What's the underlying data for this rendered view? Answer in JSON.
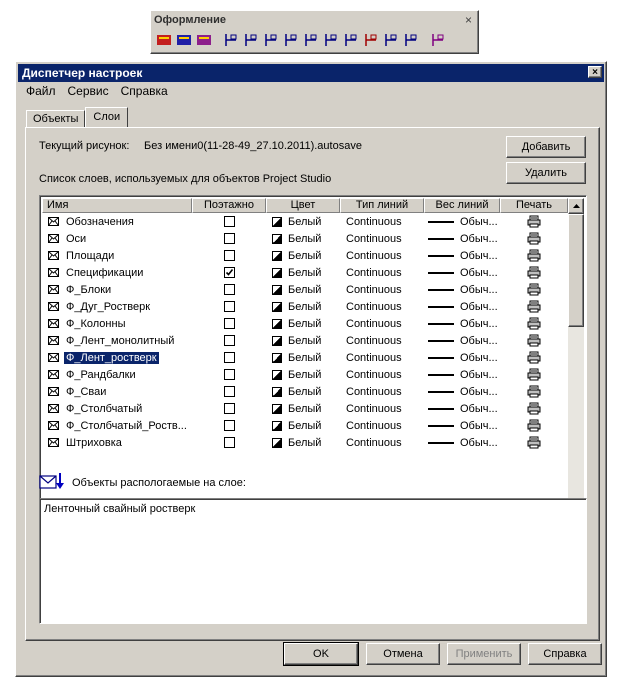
{
  "toolbar": {
    "title": "Оформление",
    "close": "×",
    "icons": [
      "layers-manager-icon",
      "layer-filter-icon",
      "layer-stack-icon",
      "leader-icon",
      "elevation-mark-icon",
      "leader-note-icon",
      "axis-mark-icon",
      "level-mark-icon",
      "frame-icon",
      "section-mark-icon",
      "view-mark-icon",
      "table-icon",
      "title-block-icon",
      "layer-settings-icon"
    ]
  },
  "dialog": {
    "title": "Диспетчер настроек",
    "close": "×",
    "menu": [
      "Файл",
      "Сервис",
      "Справка"
    ],
    "tabs": [
      "Объекты",
      "Слои"
    ],
    "active_tab": "Слои",
    "current_drawing_label": "Текущий рисунок:",
    "current_drawing_value": "Без имени0(11-28-49_27.10.2011).autosave",
    "list_label": "Список слоев, используемых для объектов Project Studio",
    "add_button": "Добавить",
    "delete_button": "Удалить",
    "columns": [
      "Имя",
      "Поэтажно",
      "Цвет",
      "Тип линий",
      "Вес линий",
      "Печать"
    ],
    "rows": [
      {
        "name": "Обозначения",
        "checked": false,
        "color": "Белый",
        "linetype": "Continuous",
        "weight": "Обыч...",
        "selected": false
      },
      {
        "name": "Оси",
        "checked": false,
        "color": "Белый",
        "linetype": "Continuous",
        "weight": "Обыч...",
        "selected": false
      },
      {
        "name": "Площади",
        "checked": false,
        "color": "Белый",
        "linetype": "Continuous",
        "weight": "Обыч...",
        "selected": false
      },
      {
        "name": "Спецификации",
        "checked": true,
        "color": "Белый",
        "linetype": "Continuous",
        "weight": "Обыч...",
        "selected": false
      },
      {
        "name": "Ф_Блоки",
        "checked": false,
        "color": "Белый",
        "linetype": "Continuous",
        "weight": "Обыч...",
        "selected": false
      },
      {
        "name": "Ф_Дуг_Ростверк",
        "checked": false,
        "color": "Белый",
        "linetype": "Continuous",
        "weight": "Обыч...",
        "selected": false
      },
      {
        "name": "Ф_Колонны",
        "checked": false,
        "color": "Белый",
        "linetype": "Continuous",
        "weight": "Обыч...",
        "selected": false
      },
      {
        "name": "Ф_Лент_монолитный",
        "checked": false,
        "color": "Белый",
        "linetype": "Continuous",
        "weight": "Обыч...",
        "selected": false
      },
      {
        "name": "Ф_Лент_ростверк",
        "checked": false,
        "color": "Белый",
        "linetype": "Continuous",
        "weight": "Обыч...",
        "selected": true
      },
      {
        "name": "Ф_Рандбалки",
        "checked": false,
        "color": "Белый",
        "linetype": "Continuous",
        "weight": "Обыч...",
        "selected": false
      },
      {
        "name": "Ф_Сваи",
        "checked": false,
        "color": "Белый",
        "linetype": "Continuous",
        "weight": "Обыч...",
        "selected": false
      },
      {
        "name": "Ф_Столбчатый",
        "checked": false,
        "color": "Белый",
        "linetype": "Continuous",
        "weight": "Обыч...",
        "selected": false
      },
      {
        "name": "Ф_Столбчатый_Роств...",
        "checked": false,
        "color": "Белый",
        "linetype": "Continuous",
        "weight": "Обыч...",
        "selected": false
      },
      {
        "name": "Штриховка",
        "checked": false,
        "color": "Белый",
        "linetype": "Continuous",
        "weight": "Обыч...",
        "selected": false
      }
    ],
    "objects_label": "Объекты распологаемые на слое:",
    "objects_text": "Ленточный свайный ростверк",
    "buttons": {
      "ok": "OK",
      "cancel": "Отмена",
      "apply": "Применить",
      "help": "Справка"
    }
  }
}
